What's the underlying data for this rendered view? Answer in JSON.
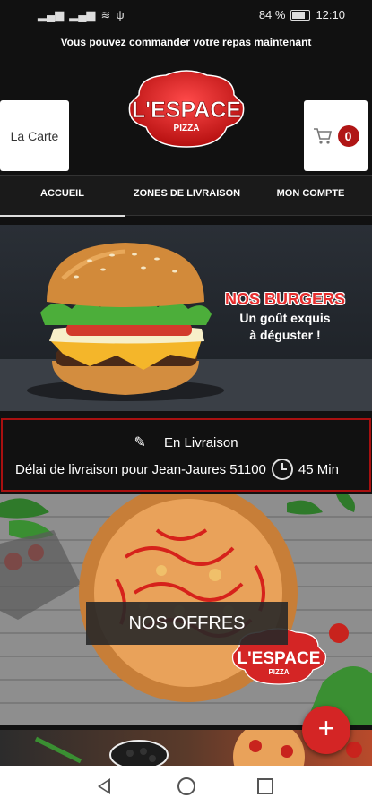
{
  "status_bar": {
    "battery": "84 %",
    "time": "12:10"
  },
  "banner": {
    "text": "Vous pouvez commander votre repas maintenant"
  },
  "header": {
    "menu_button": "La Carte",
    "cart_count": "0",
    "logo_main": "L'ESPACE",
    "logo_sub": "PIZZA"
  },
  "nav": {
    "items": [
      {
        "label": "ACCUEIL"
      },
      {
        "label": "ZONES DE LIVRAISON"
      },
      {
        "label": "MON COMPTE"
      }
    ]
  },
  "burger_promo": {
    "title": "NOS BURGERS",
    "line1": "Un goût exquis",
    "line2": "à déguster !"
  },
  "delivery": {
    "mode": "En Livraison",
    "delay_text": "Délai de livraison pour Jean-Jaures 51100",
    "delay_value": "45 Min"
  },
  "offers": {
    "label": "NOS OFFRES",
    "logo_main": "L'ESPACE",
    "logo_sub": "PIZZA"
  },
  "fab": {
    "label": "+"
  },
  "colors": {
    "brand_red": "#d42525",
    "dark_bg": "#111111"
  }
}
